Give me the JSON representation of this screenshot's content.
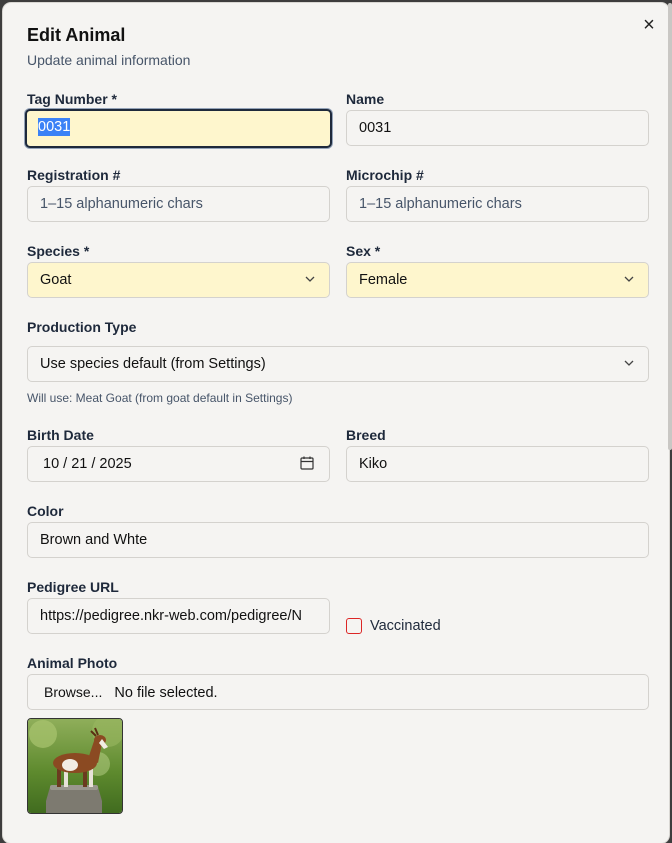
{
  "dialog": {
    "title": "Edit Animal",
    "subtitle": "Update animal information",
    "close_icon": "×"
  },
  "fields": {
    "tag_number": {
      "label": "Tag Number *",
      "value": "0031"
    },
    "name": {
      "label": "Name",
      "value": "0031"
    },
    "registration": {
      "label": "Registration #",
      "placeholder": "1–15 alphanumeric chars"
    },
    "microchip": {
      "label": "Microchip #",
      "placeholder": "1–15 alphanumeric chars"
    },
    "species": {
      "label": "Species *",
      "value": "Goat"
    },
    "sex": {
      "label": "Sex *",
      "value": "Female"
    },
    "production_type": {
      "label": "Production Type",
      "value": "Use species default (from Settings)",
      "hint": "Will use: Meat Goat (from goat default in Settings)"
    },
    "birth_date": {
      "label": "Birth Date",
      "value": "10 / 21 / 2025"
    },
    "breed": {
      "label": "Breed",
      "value": "Kiko"
    },
    "color": {
      "label": "Color",
      "value": "Brown and Whte"
    },
    "pedigree_url": {
      "label": "Pedigree URL",
      "value": "https://pedigree.nkr-web.com/pedigree/N"
    },
    "vaccinated": {
      "label": "Vaccinated",
      "checked": false
    },
    "photo": {
      "label": "Animal Photo",
      "button": "Browse...",
      "status": "No file selected."
    }
  },
  "colors": {
    "required_highlight": "#fef6cd",
    "checkbox_border": "#dc2626"
  }
}
